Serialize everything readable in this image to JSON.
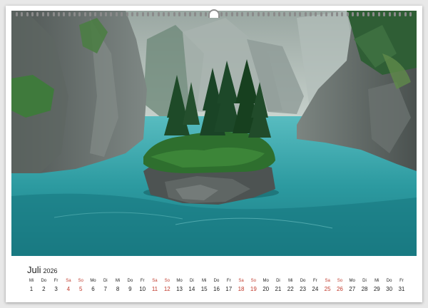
{
  "calendar": {
    "month": "Juli",
    "year": "2026",
    "weekend_color": "#c0392b",
    "days": [
      {
        "wd": "Mi",
        "d": "1"
      },
      {
        "wd": "Do",
        "d": "2"
      },
      {
        "wd": "Fr",
        "d": "3"
      },
      {
        "wd": "Sa",
        "d": "4"
      },
      {
        "wd": "So",
        "d": "5"
      },
      {
        "wd": "Mo",
        "d": "6"
      },
      {
        "wd": "Di",
        "d": "7"
      },
      {
        "wd": "Mi",
        "d": "8"
      },
      {
        "wd": "Do",
        "d": "9"
      },
      {
        "wd": "Fr",
        "d": "10"
      },
      {
        "wd": "Sa",
        "d": "11"
      },
      {
        "wd": "So",
        "d": "12"
      },
      {
        "wd": "Mo",
        "d": "13"
      },
      {
        "wd": "Di",
        "d": "14"
      },
      {
        "wd": "Mi",
        "d": "15"
      },
      {
        "wd": "Do",
        "d": "16"
      },
      {
        "wd": "Fr",
        "d": "17"
      },
      {
        "wd": "Sa",
        "d": "18"
      },
      {
        "wd": "So",
        "d": "19"
      },
      {
        "wd": "Mo",
        "d": "20"
      },
      {
        "wd": "Di",
        "d": "21"
      },
      {
        "wd": "Mi",
        "d": "22"
      },
      {
        "wd": "Do",
        "d": "23"
      },
      {
        "wd": "Fr",
        "d": "24"
      },
      {
        "wd": "Sa",
        "d": "25"
      },
      {
        "wd": "So",
        "d": "26"
      },
      {
        "wd": "Mo",
        "d": "27"
      },
      {
        "wd": "Di",
        "d": "28"
      },
      {
        "wd": "Mi",
        "d": "29"
      },
      {
        "wd": "Do",
        "d": "30"
      },
      {
        "wd": "Fr",
        "d": "31"
      }
    ]
  }
}
